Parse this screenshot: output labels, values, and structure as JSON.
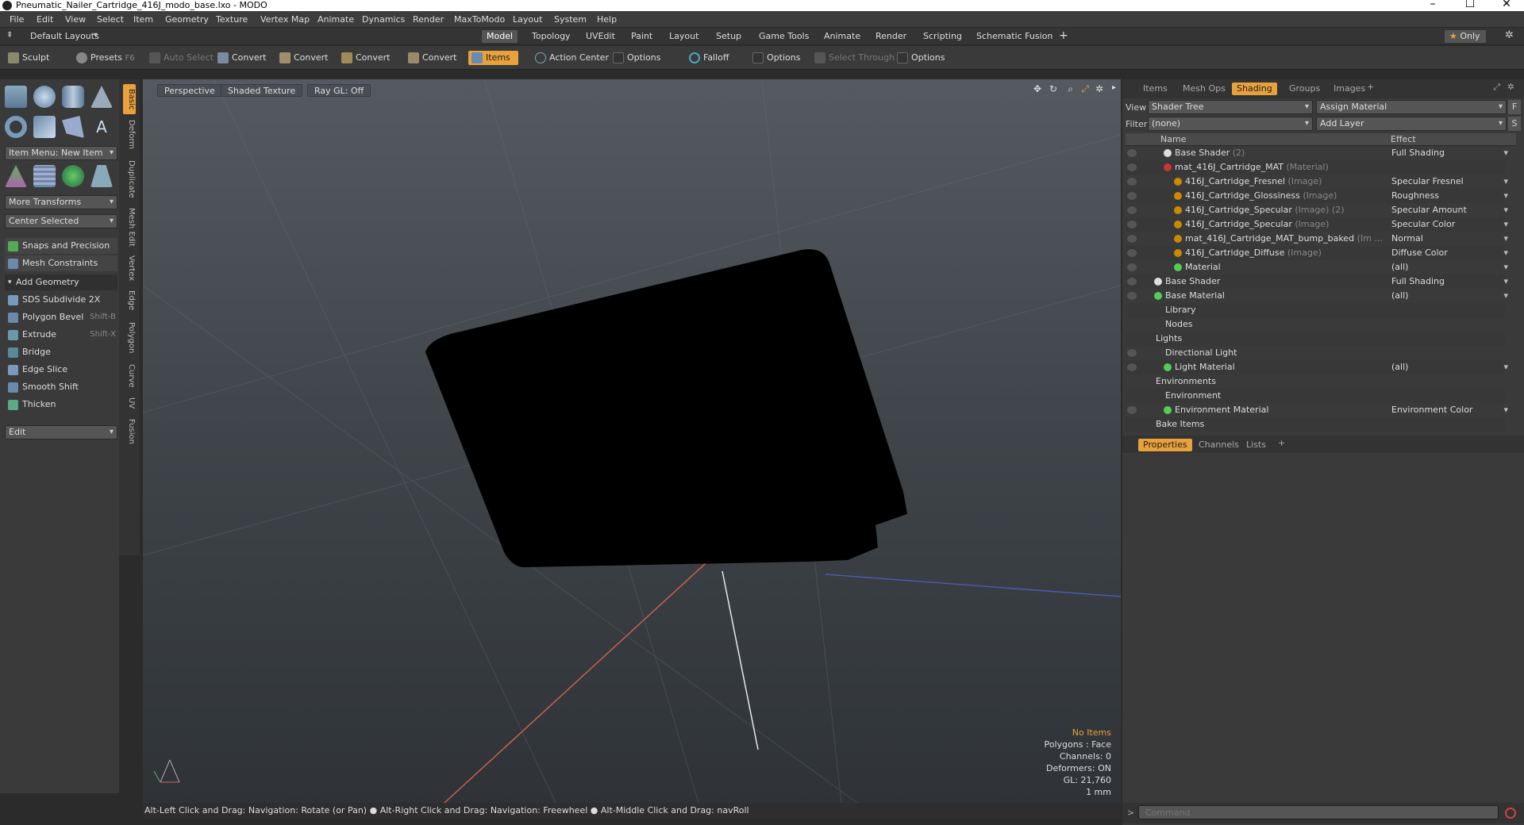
{
  "window": {
    "title": "Pneumatic_Nailer_Cartridge_416J_modo_base.lxo - MODO"
  },
  "menu": [
    "File",
    "Edit",
    "View",
    "Select",
    "Item",
    "Geometry",
    "Texture",
    "Vertex Map",
    "Animate",
    "Dynamics",
    "Render",
    "MaxToModo",
    "Layout",
    "System",
    "Help"
  ],
  "layouts": {
    "default": "Default Layouts",
    "tabs": [
      "Model",
      "Topology",
      "UVEdit",
      "Paint",
      "Layout",
      "Setup",
      "Game Tools",
      "Animate",
      "Render",
      "Scripting",
      "Schematic Fusion"
    ],
    "active_tab": "Model",
    "only": "Only"
  },
  "toolbar": {
    "sculpt": "Sculpt",
    "presets": "Presets",
    "presets_key": "F6",
    "auto_select": "Auto Select",
    "convert1": "Convert",
    "convert2": "Convert",
    "convert3": "Convert",
    "convert4": "Convert",
    "items": "Items",
    "action_center": "Action Center",
    "options1": "Options",
    "falloff": "Falloff",
    "options2": "Options",
    "select_through": "Select Through",
    "options3": "Options"
  },
  "left": {
    "item_menu": "Item Menu: New Item",
    "more_transforms": "More Transforms",
    "center_selected": "Center Selected",
    "snaps": "Snaps and Precision",
    "mesh_constraints": "Mesh Constraints",
    "add_geometry": "Add Geometry",
    "tools": [
      {
        "label": "SDS Subdivide 2X",
        "shortcut": ""
      },
      {
        "label": "Polygon Bevel",
        "shortcut": "Shift-B"
      },
      {
        "label": "Extrude",
        "shortcut": "Shift-X"
      },
      {
        "label": "Bridge",
        "shortcut": ""
      },
      {
        "label": "Edge Slice",
        "shortcut": ""
      },
      {
        "label": "Smooth Shift",
        "shortcut": ""
      },
      {
        "label": "Thicken",
        "shortcut": ""
      }
    ],
    "edit": "Edit",
    "side_tabs": [
      "Basic",
      "Deform",
      "Duplicate",
      "Mesh Edit",
      "Vertex",
      "Edge",
      "Polygon",
      "Curve",
      "UV",
      "Fusion"
    ]
  },
  "viewport": {
    "perspective": "Perspective",
    "shaded": "Shaded Texture",
    "raygl": "Ray GL: Off",
    "info": {
      "no_items": "No Items",
      "polygons": "Polygons : Face",
      "channels": "Channels: 0",
      "deformers": "Deformers: ON",
      "gl": "GL: 21,760",
      "unit": "1 mm"
    }
  },
  "status": "Alt-Left Click and Drag: Navigation: Rotate (or Pan) ● Alt-Right Click and Drag: Navigation: Freewheel ● Alt-Middle Click and Drag: navRoll",
  "right": {
    "tabs": [
      "Items",
      "Mesh Ops",
      "Shading",
      "Groups",
      "Images"
    ],
    "active_tab": "Shading",
    "view_label": "View",
    "view_value": "Shader Tree",
    "assign_material": "Assign Material",
    "filter_label": "Filter",
    "filter_value": "(none)",
    "add_layer": "Add Layer",
    "col_name": "Name",
    "col_effect": "Effect",
    "rows": [
      {
        "name": "Base Shader",
        "tag": "(2)",
        "effect": "Full Shading",
        "indent": 62
      },
      {
        "name": "mat_416J_Cartridge_MAT",
        "tag": "(Material)",
        "effect": "",
        "indent": 62
      },
      {
        "name": "416J_Cartridge_Fresnel",
        "tag": "(Image)",
        "effect": "Specular Fresnel",
        "indent": 75
      },
      {
        "name": "416J_Cartridge_Glossiness",
        "tag": "(Image)",
        "effect": "Roughness",
        "indent": 75
      },
      {
        "name": "416J_Cartridge_Specular",
        "tag": "(Image) (2)",
        "effect": "Specular Amount",
        "indent": 75
      },
      {
        "name": "416J_Cartridge_Specular",
        "tag": "(Image)",
        "effect": "Specular Color",
        "indent": 75
      },
      {
        "name": "mat_416J_Cartridge_MAT_bump_baked",
        "tag": "(Im ...",
        "effect": "Normal",
        "indent": 75
      },
      {
        "name": "416J_Cartridge_Diffuse",
        "tag": "(Image)",
        "effect": "Diffuse Color",
        "indent": 75
      },
      {
        "name": "Material",
        "tag": "",
        "effect": "(all)",
        "indent": 75
      },
      {
        "name": "Base Shader",
        "tag": "",
        "effect": "Full Shading",
        "indent": 50
      },
      {
        "name": "Base Material",
        "tag": "",
        "effect": "(all)",
        "indent": 50
      },
      {
        "name": "Library",
        "tag": "",
        "effect": "",
        "indent": 50
      },
      {
        "name": "Nodes",
        "tag": "",
        "effect": "",
        "indent": 50
      },
      {
        "name": "Lights",
        "tag": "",
        "effect": "",
        "indent": 38
      },
      {
        "name": "Directional Light",
        "tag": "",
        "effect": "",
        "indent": 50
      },
      {
        "name": "Light Material",
        "tag": "",
        "effect": "(all)",
        "indent": 62
      },
      {
        "name": "Environments",
        "tag": "",
        "effect": "",
        "indent": 38
      },
      {
        "name": "Environment",
        "tag": "",
        "effect": "",
        "indent": 50
      },
      {
        "name": "Environment Material",
        "tag": "",
        "effect": "Environment Color",
        "indent": 62
      },
      {
        "name": "Bake Items",
        "tag": "",
        "effect": "",
        "indent": 38
      }
    ],
    "props_tabs": [
      "Properties",
      "Channels",
      "Lists"
    ],
    "props_active": "Properties",
    "command_placeholder": "Command"
  },
  "colors": {
    "accent": "#e8a13b"
  }
}
